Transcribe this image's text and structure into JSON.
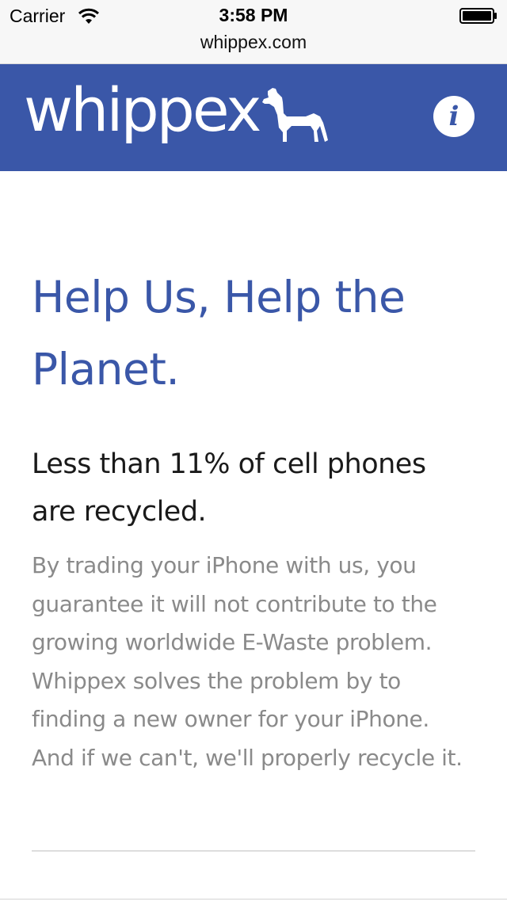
{
  "status_bar": {
    "carrier": "Carrier",
    "time": "3:58 PM",
    "url": "whippex.com",
    "icons": [
      "wifi-icon",
      "battery-icon"
    ]
  },
  "header": {
    "logo_text": "whippex",
    "logo_icon": "whippet-dog-icon",
    "info_glyph": "i",
    "background_color": "#3a57a8"
  },
  "main": {
    "title": "Help Us, Help the Planet.",
    "subtitle": "Less than 11% of cell phones are recycled.",
    "body": "By trading your iPhone with us, you guarantee it will not contribute to the growing worldwide E-Waste problem. Whippex solves the problem by to finding a new owner for your iPhone. And if we can't, we'll properly recycle it."
  },
  "colors": {
    "accent": "#3a57a8",
    "body_text": "#8a8a8a",
    "subtitle_text": "#1a1a1a"
  }
}
